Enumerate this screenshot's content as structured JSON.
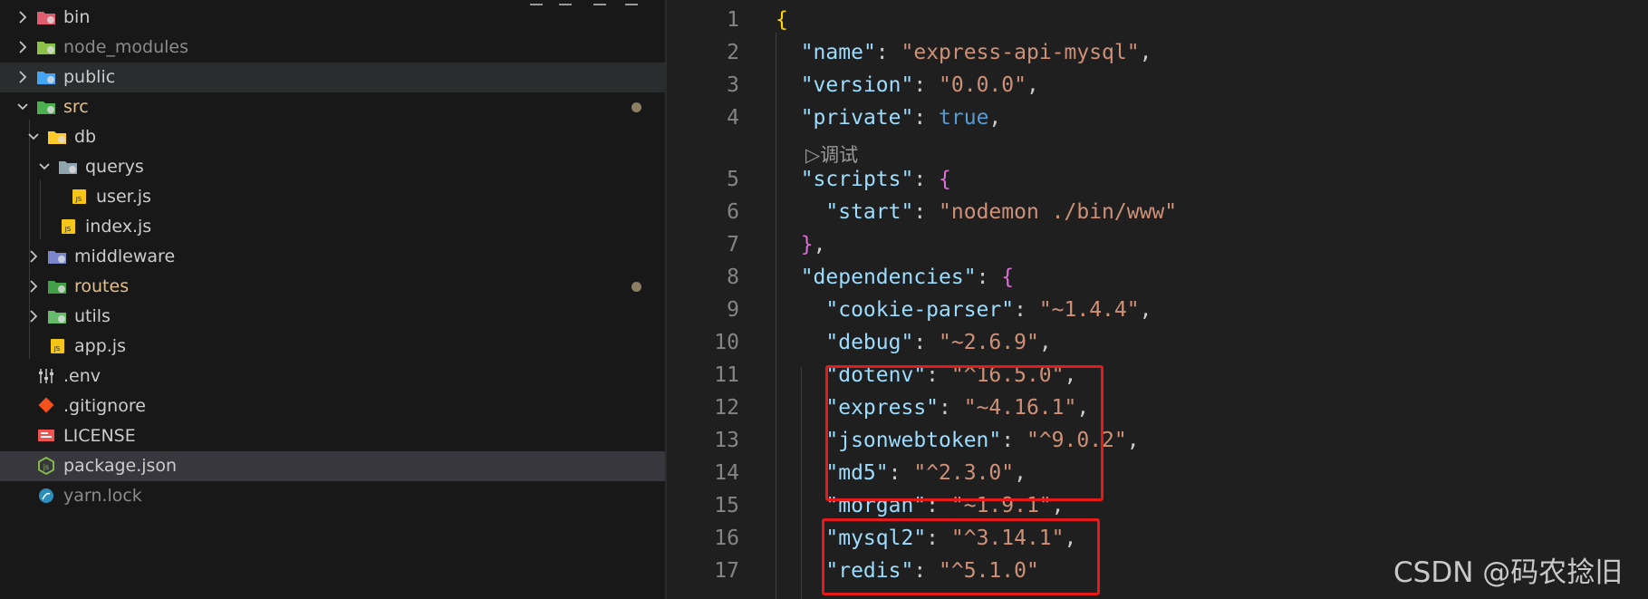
{
  "explorer": {
    "items": [
      {
        "label": "bin",
        "icon": "folder-bin-icon",
        "expanded": false,
        "status": "normal"
      },
      {
        "label": "node_modules",
        "icon": "folder-node-icon",
        "expanded": false,
        "status": "dimmed"
      },
      {
        "label": "public",
        "icon": "folder-public-icon",
        "expanded": false,
        "status": "normal"
      },
      {
        "label": "src",
        "icon": "folder-src-icon",
        "expanded": true,
        "status": "modified"
      },
      {
        "label": "db",
        "icon": "folder-db-icon",
        "expanded": true,
        "status": "normal"
      },
      {
        "label": "querys",
        "icon": "folder-open-icon",
        "expanded": true,
        "status": "normal"
      },
      {
        "label": "user.js",
        "icon": "js-file-icon",
        "status": "normal"
      },
      {
        "label": "index.js",
        "icon": "js-file-icon",
        "status": "normal"
      },
      {
        "label": "middleware",
        "icon": "folder-middleware-icon",
        "expanded": false,
        "status": "normal"
      },
      {
        "label": "routes",
        "icon": "folder-routes-icon",
        "expanded": false,
        "status": "modified"
      },
      {
        "label": "utils",
        "icon": "folder-utils-icon",
        "expanded": false,
        "status": "normal"
      },
      {
        "label": "app.js",
        "icon": "js-file-icon",
        "status": "normal"
      },
      {
        "label": ".env",
        "icon": "env-settings-icon",
        "status": "normal"
      },
      {
        "label": ".gitignore",
        "icon": "git-icon",
        "status": "normal"
      },
      {
        "label": "LICENSE",
        "icon": "license-icon",
        "status": "normal"
      },
      {
        "label": "package.json",
        "icon": "nodejs-icon",
        "status": "selected"
      },
      {
        "label": "yarn.lock",
        "icon": "yarn-icon",
        "status": "dimmed"
      }
    ]
  },
  "editor": {
    "codelens": "▷调试",
    "lines": [
      {
        "n": "1",
        "segs": [
          [
            "{",
            "b1"
          ]
        ]
      },
      {
        "n": "2",
        "segs": [
          [
            "  ",
            "p"
          ],
          [
            "\"name\"",
            "k"
          ],
          [
            ": ",
            "p"
          ],
          [
            "\"express-api-mysql\"",
            "s"
          ],
          [
            ",",
            "p"
          ]
        ]
      },
      {
        "n": "3",
        "segs": [
          [
            "  ",
            "p"
          ],
          [
            "\"version\"",
            "k"
          ],
          [
            ": ",
            "p"
          ],
          [
            "\"0.0.0\"",
            "s"
          ],
          [
            ",",
            "p"
          ]
        ]
      },
      {
        "n": "4",
        "segs": [
          [
            "  ",
            "p"
          ],
          [
            "\"private\"",
            "k"
          ],
          [
            ": ",
            "p"
          ],
          [
            "true",
            "kw"
          ],
          [
            ",",
            "p"
          ]
        ]
      },
      {
        "n": "5",
        "segs": [
          [
            "  ",
            "p"
          ],
          [
            "\"scripts\"",
            "k"
          ],
          [
            ": ",
            "p"
          ],
          [
            "{",
            "b2"
          ]
        ]
      },
      {
        "n": "6",
        "segs": [
          [
            "    ",
            "p"
          ],
          [
            "\"start\"",
            "k"
          ],
          [
            ": ",
            "p"
          ],
          [
            "\"nodemon ./bin/www\"",
            "s"
          ]
        ]
      },
      {
        "n": "7",
        "segs": [
          [
            "  ",
            "p"
          ],
          [
            "}",
            "b2"
          ],
          [
            ",",
            "p"
          ]
        ]
      },
      {
        "n": "8",
        "segs": [
          [
            "  ",
            "p"
          ],
          [
            "\"dependencies\"",
            "k"
          ],
          [
            ": ",
            "p"
          ],
          [
            "{",
            "b2"
          ]
        ]
      },
      {
        "n": "9",
        "segs": [
          [
            "    ",
            "p"
          ],
          [
            "\"cookie-parser\"",
            "k"
          ],
          [
            ": ",
            "p"
          ],
          [
            "\"~1.4.4\"",
            "s"
          ],
          [
            ",",
            "p"
          ]
        ]
      },
      {
        "n": "10",
        "segs": [
          [
            "    ",
            "p"
          ],
          [
            "\"debug\"",
            "k"
          ],
          [
            ": ",
            "p"
          ],
          [
            "\"~2.6.9\"",
            "s"
          ],
          [
            ",",
            "p"
          ]
        ]
      },
      {
        "n": "11",
        "segs": [
          [
            "    ",
            "p"
          ],
          [
            "\"dotenv\"",
            "k"
          ],
          [
            ": ",
            "p"
          ],
          [
            "\"^16.5.0\"",
            "s"
          ],
          [
            ",",
            "p"
          ]
        ]
      },
      {
        "n": "12",
        "segs": [
          [
            "    ",
            "p"
          ],
          [
            "\"express\"",
            "k"
          ],
          [
            ": ",
            "p"
          ],
          [
            "\"~4.16.1\"",
            "s"
          ],
          [
            ",",
            "p"
          ]
        ]
      },
      {
        "n": "13",
        "segs": [
          [
            "    ",
            "p"
          ],
          [
            "\"jsonwebtoken\"",
            "k"
          ],
          [
            ": ",
            "p"
          ],
          [
            "\"^9.0.2\"",
            "s"
          ],
          [
            ",",
            "p"
          ]
        ]
      },
      {
        "n": "14",
        "segs": [
          [
            "    ",
            "p"
          ],
          [
            "\"md5\"",
            "k"
          ],
          [
            ": ",
            "p"
          ],
          [
            "\"^2.3.0\"",
            "s"
          ],
          [
            ",",
            "p"
          ]
        ]
      },
      {
        "n": "15",
        "segs": [
          [
            "    ",
            "p"
          ],
          [
            "\"morgan\"",
            "k"
          ],
          [
            ": ",
            "p"
          ],
          [
            "\"~1.9.1\"",
            "s"
          ],
          [
            ",",
            "p"
          ]
        ]
      },
      {
        "n": "16",
        "segs": [
          [
            "    ",
            "p"
          ],
          [
            "\"mysql2\"",
            "k"
          ],
          [
            ": ",
            "p"
          ],
          [
            "\"^3.14.1\"",
            "s"
          ],
          [
            ",",
            "p"
          ]
        ]
      },
      {
        "n": "17",
        "segs": [
          [
            "    ",
            "p"
          ],
          [
            "\"redis\"",
            "k"
          ],
          [
            ": ",
            "p"
          ],
          [
            "\"^5.1.0\"",
            "s"
          ]
        ]
      }
    ]
  },
  "watermark": "CSDN @码农捻旧",
  "colors": {
    "highlight_box": "#e51b1b",
    "json_key": "#9cdcfe",
    "json_string": "#ce9178",
    "json_keyword": "#569cd6",
    "modified_label": "#e2c08d"
  }
}
